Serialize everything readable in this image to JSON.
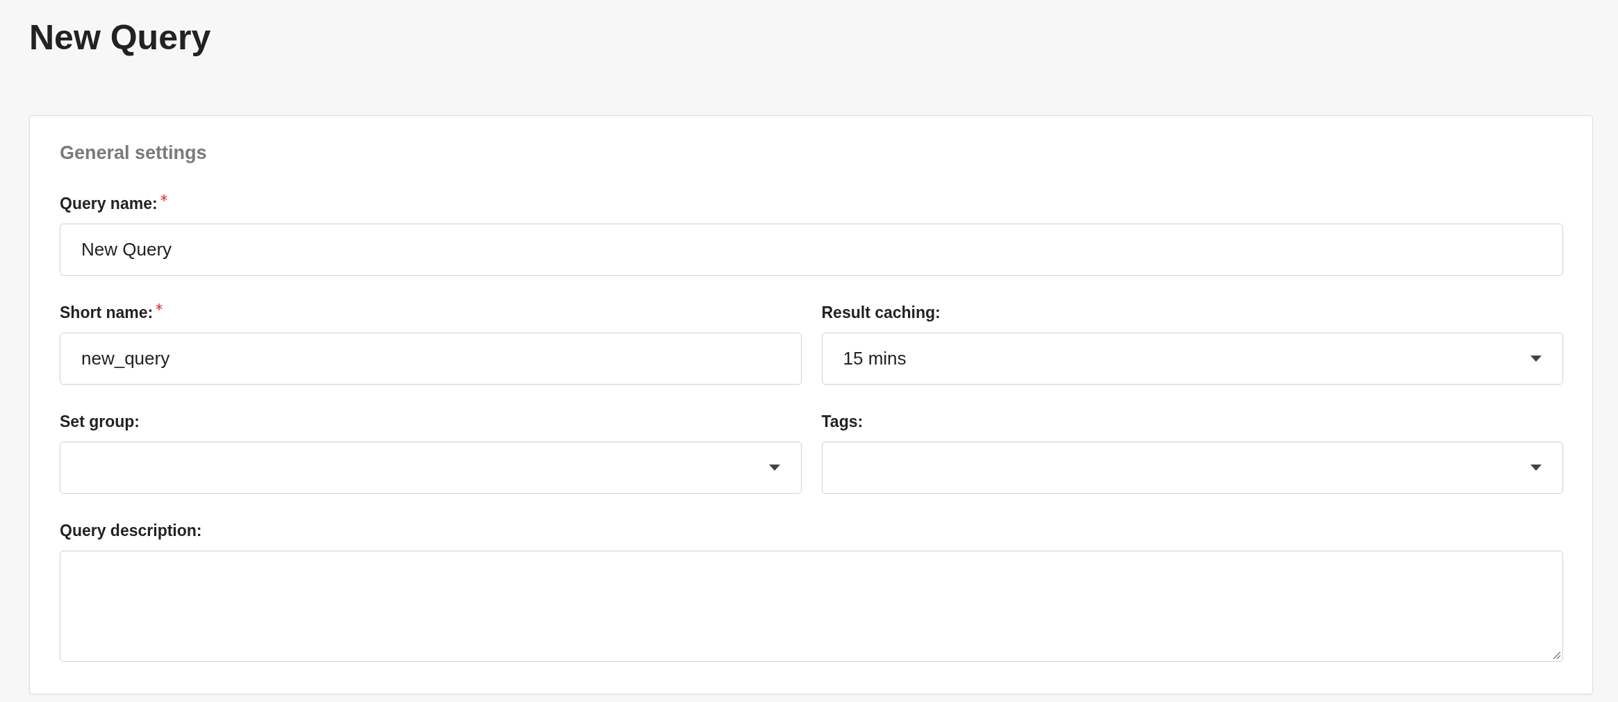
{
  "page_title": "New Query",
  "section": {
    "title": "General settings",
    "rows": [
      [
        {
          "label": "Query name:",
          "required": true,
          "kind": "text",
          "value": "New Query"
        }
      ],
      [
        {
          "label": "Short name:",
          "required": true,
          "kind": "text",
          "value": "new_query"
        },
        {
          "label": "Result caching:",
          "required": false,
          "kind": "select",
          "value": "15 mins"
        }
      ],
      [
        {
          "label": "Set group:",
          "required": false,
          "kind": "select"
        },
        {
          "label": "Tags:",
          "required": false,
          "kind": "select"
        }
      ],
      [
        {
          "label": "Query description:",
          "required": false,
          "kind": "textarea"
        }
      ]
    ]
  }
}
